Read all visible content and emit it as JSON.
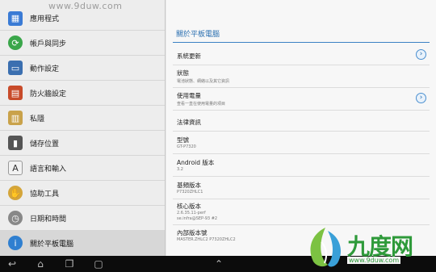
{
  "sidebar": {
    "items": [
      {
        "label": "應用程式",
        "icon": "apps-icon",
        "color": "#3a7bd5"
      },
      {
        "label": "帳戶與同步",
        "icon": "sync-icon",
        "color": "#3aa64a"
      },
      {
        "label": "動作設定",
        "icon": "motion-icon",
        "color": "#3b6fb0"
      },
      {
        "label": "防火牆設定",
        "icon": "firewall-icon",
        "color": "#c84b2a"
      },
      {
        "label": "私隱",
        "icon": "privacy-icon",
        "color": "#c9a24a"
      },
      {
        "label": "儲存位置",
        "icon": "storage-icon",
        "color": "#555555"
      },
      {
        "label": "語言和輸入",
        "icon": "language-icon",
        "color": "#777777"
      },
      {
        "label": "協助工具",
        "icon": "accessibility-icon",
        "color": "#d4a53a"
      },
      {
        "label": "日期和時間",
        "icon": "clock-icon",
        "color": "#888888"
      },
      {
        "label": "關於平板電腦",
        "icon": "info-icon",
        "color": "#2f7fd0"
      }
    ]
  },
  "panel": {
    "title": "關於平板電腦",
    "rows": [
      {
        "title": "系統更新",
        "sub": "",
        "chevron": true
      },
      {
        "title": "狀態",
        "sub": "電池狀態、網絡以及其它資訊",
        "chevron": false
      },
      {
        "title": "使用電量",
        "sub": "查看一直在使用電量的項目",
        "chevron": true
      },
      {
        "title": "法律資訊",
        "sub": "",
        "chevron": false
      },
      {
        "title": "型號",
        "sub": "GT-P7320",
        "chevron": false
      },
      {
        "title": "Android 版本",
        "sub": "3.2",
        "chevron": false
      },
      {
        "title": "基頻版本",
        "sub": "P7320ZHLC1",
        "chevron": false
      },
      {
        "title": "核心版本",
        "sub": "2.6.35.11-perf",
        "sub2": "se.infra@SEP-93 #2",
        "chevron": false
      },
      {
        "title": "內部版本號",
        "sub": "MASTER.ZHLC2 P7320ZHLC2",
        "chevron": false
      }
    ]
  },
  "watermark": {
    "top": "www.9duw.com",
    "logo_text": "九度网",
    "logo_url": "www.9duw.com"
  }
}
